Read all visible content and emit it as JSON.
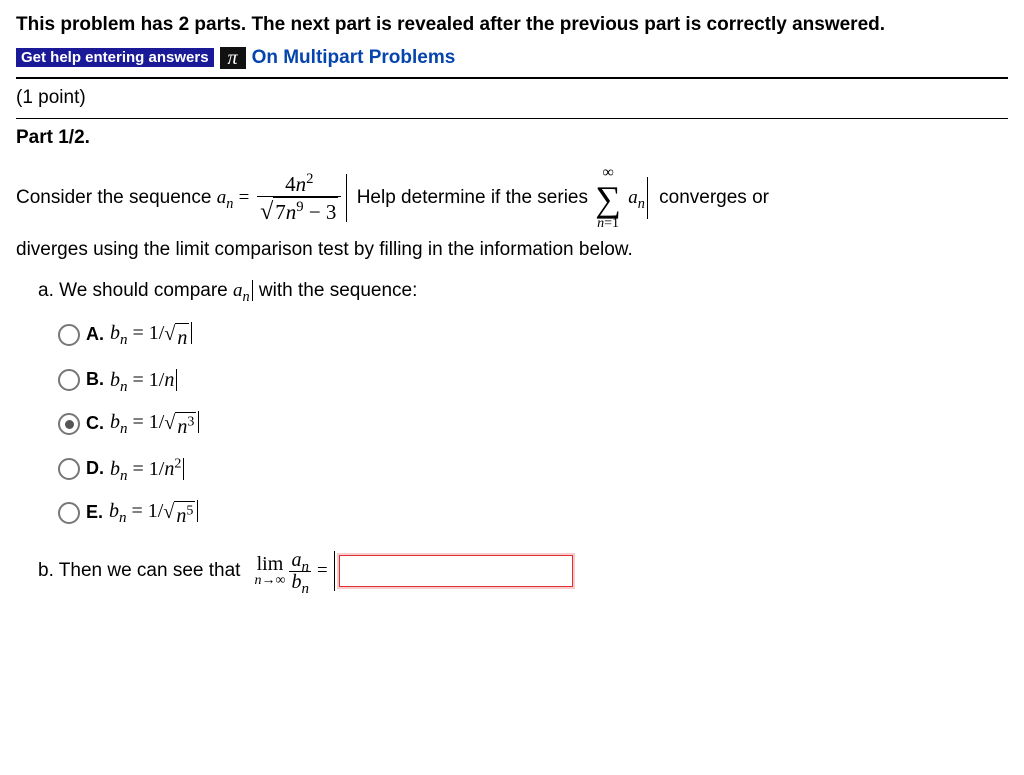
{
  "instruction": "This problem has 2 parts. The next part is revealed after the previous part is correctly answered.",
  "help_button": "Get help entering answers",
  "pi_label": "π",
  "help_link": "On Multipart Problems",
  "points_label": "(1 point)",
  "part_label": "Part 1/2.",
  "prose": {
    "p1a": "Consider the sequence ",
    "p1b": "Help determine if the series",
    "p1c": "converges or",
    "p2": "diverges using the limit comparison test by filling in the information below.",
    "qa_intro": "a. We should compare ",
    "qa_tail": " with the sequence:",
    "qb_intro": "b. Then we can see that"
  },
  "math": {
    "a_seq": "aₙ",
    "eq": " = ",
    "frac_num_4": "4",
    "frac_num_n": "n",
    "frac_num_exp": "2",
    "den_coeff": "7",
    "den_var": "n",
    "den_exp": "9",
    "den_minus": " − 3",
    "sum_top": "∞",
    "sum_bot_lhs": "n",
    "sum_bot_eq": "=",
    "sum_bot_rhs": "1",
    "an_var": "a",
    "an_sub": "n",
    "lim_label": "lim",
    "lim_sub_n": "n",
    "lim_sub_arrow": "→∞",
    "bn_var": "b",
    "bn_sub": "n"
  },
  "options": {
    "A": {
      "label": "A.",
      "lhs_b": "b",
      "lhs_n": "n",
      "eq": " = 1/",
      "body_n": "n"
    },
    "B": {
      "label": "B.",
      "lhs_b": "b",
      "lhs_n": "n",
      "eq": " = 1/",
      "body": "n"
    },
    "C": {
      "label": "C.",
      "lhs_b": "b",
      "lhs_n": "n",
      "eq": " = 1/",
      "body_n": "n",
      "body_exp": "3"
    },
    "D": {
      "label": "D.",
      "lhs_b": "b",
      "lhs_n": "n",
      "eq": " = 1/",
      "body_n": "n",
      "body_exp": "2"
    },
    "E": {
      "label": "E.",
      "lhs_b": "b",
      "lhs_n": "n",
      "eq": " = 1/",
      "body_n": "n",
      "body_exp": "5"
    }
  },
  "selected_option": "C",
  "answer_value": ""
}
